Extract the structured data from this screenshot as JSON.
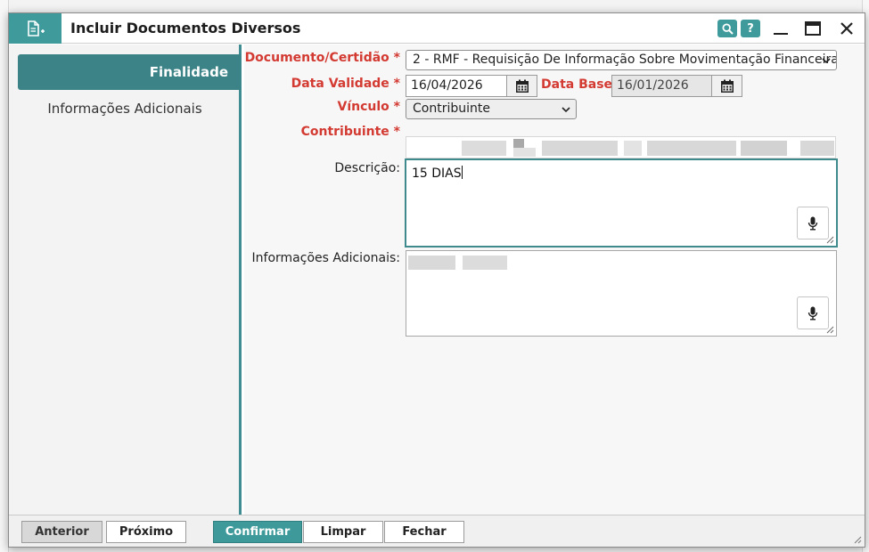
{
  "dialog": {
    "title": "Incluir Documentos Diversos",
    "icons": {
      "title_icon": "add-document-icon",
      "search": "search-icon",
      "help_label": "?"
    }
  },
  "sidebar": {
    "items": [
      {
        "label": "Finalidade",
        "active": true
      },
      {
        "label": "Informações Adicionais",
        "active": false
      }
    ]
  },
  "form": {
    "documento": {
      "label": "Documento/Certidão *",
      "value": "2 - RMF - Requisição De Informação Sobre Movimentação Financeira"
    },
    "data_validade": {
      "label": "Data Validade *",
      "value": "16/04/2026"
    },
    "data_base": {
      "label": "Data Base *",
      "value": "16/01/2026"
    },
    "vinculo": {
      "label": "Vínculo *",
      "value": "Contribuinte"
    },
    "contribuinte": {
      "label": "Contribuinte *"
    },
    "descricao": {
      "label": "Descrição:",
      "value": "15 DIAS"
    },
    "info_adicionais": {
      "label": "Informações Adicionais:"
    }
  },
  "footer": {
    "anterior": "Anterior",
    "proximo": "Próximo",
    "confirmar": "Confirmar",
    "limpar": "Limpar",
    "fechar": "Fechar"
  },
  "colors": {
    "accent": "#3f9a9b",
    "required": "#d33a32",
    "sidebar_active": "#3c8387"
  }
}
